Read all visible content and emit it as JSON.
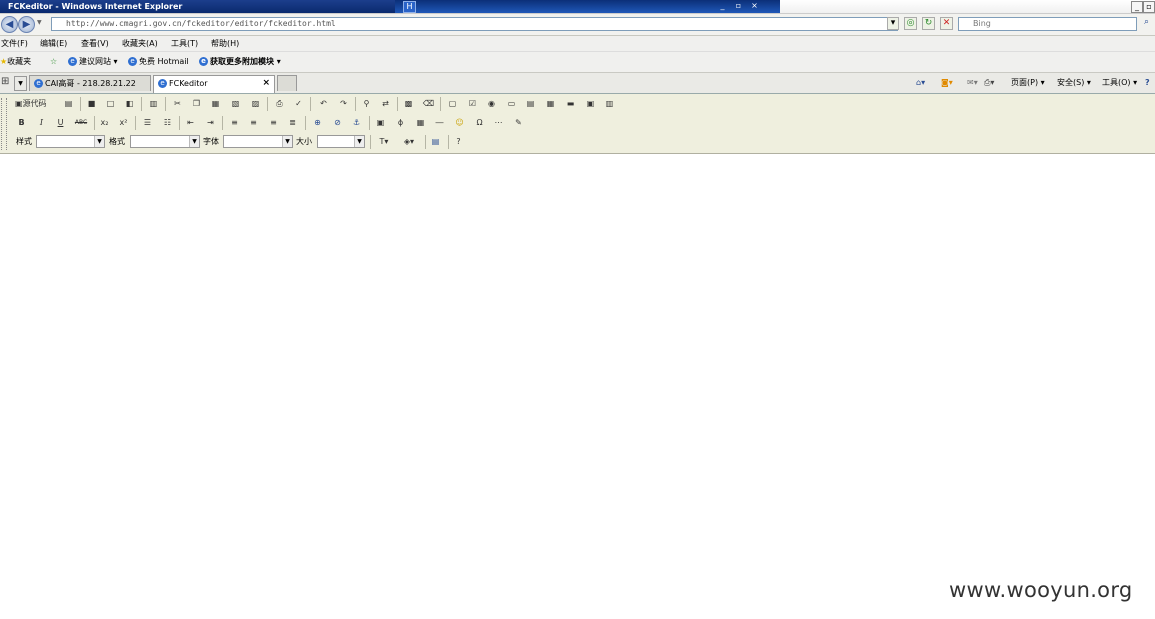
{
  "window": {
    "title": "FCKeditor - Windows Internet Explorer"
  },
  "address": {
    "url": "http://www.cmagri.gov.cn/fckeditor/editor/fckeditor.html",
    "search_placeholder": "Bing"
  },
  "menu": [
    "文件(F)",
    "编辑(E)",
    "查看(V)",
    "收藏夹(A)",
    "工具(T)",
    "帮助(H)"
  ],
  "favorites": {
    "label": "收藏夹",
    "items": [
      "建议网站 ▾",
      "免费 Hotmail",
      "获取更多附加模块 ▾"
    ]
  },
  "tabs": [
    {
      "title": "CAI高哥 - 218.28.21.22"
    },
    {
      "title": "FCKeditor"
    }
  ],
  "command_bar": {
    "page": "页面(P) ▾",
    "safety": "安全(S) ▾",
    "tools": "工具(O) ▾"
  },
  "editor": {
    "source_button": "源代码",
    "style_label": "样式",
    "format_label": "格式",
    "font_label": "字体",
    "size_label": "大小"
  },
  "watermark": "www.wooyun.org"
}
